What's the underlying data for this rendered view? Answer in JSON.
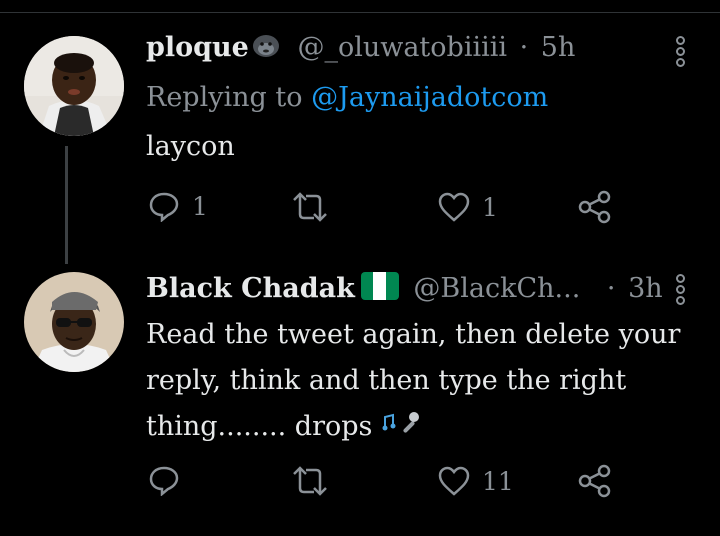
{
  "tweet1": {
    "display_name": "ploque",
    "name_emoji": "gorilla-emoji",
    "handle": "@_oluwatobiiiii",
    "separator": "·",
    "time": "5h",
    "replying_prefix": "Replying to",
    "replying_to": "@Jaynaijadotcom",
    "text": "laycon",
    "reply_count": "1",
    "retweet_count": "",
    "like_count": "1"
  },
  "tweet2": {
    "display_name": "Black Chadak",
    "name_emoji": "nigeria-flag",
    "handle": "@BlackCh...",
    "separator": "·",
    "time": "3h",
    "text_line1": "Read the tweet again, then delete your",
    "text_line2": "reply, think and then type the right",
    "text_line3": "thing........ drops",
    "text_emoji": "microphone-emoji",
    "reply_count": "",
    "retweet_count": "",
    "like_count": "11"
  },
  "colors": {
    "background": "#000000",
    "text": "#e7e9ea",
    "muted": "#8b9197",
    "link": "#1d9bf0",
    "flag_green": "#008751"
  }
}
